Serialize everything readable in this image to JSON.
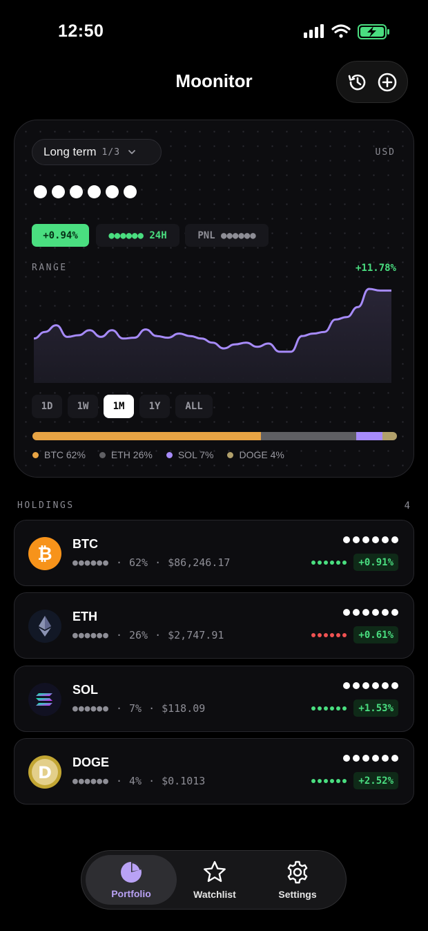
{
  "status_bar": {
    "time": "12:50"
  },
  "app": {
    "title": "Moonitor"
  },
  "header_actions": {
    "history_icon": "history-icon",
    "add_icon": "plus-circle-icon"
  },
  "portfolio": {
    "name": "Long term",
    "index": "1/3",
    "currency": "USD",
    "change_24h_percent": "+0.94%",
    "change_24h_label": "●●●●●● 24H",
    "pnl_label": "PNL ●●●●●●",
    "range_label": "RANGE",
    "range_change": "+11.78%",
    "accent_color": "#a78bfa",
    "positive_color": "#4ade80"
  },
  "chart_data": {
    "type": "area",
    "values": [
      52,
      60,
      68,
      54,
      56,
      62,
      54,
      62,
      52,
      53,
      63,
      55,
      53,
      58,
      55,
      52,
      47,
      40,
      45,
      47,
      42,
      46,
      36,
      36,
      55,
      58,
      60,
      75,
      78,
      90,
      112,
      110,
      110
    ]
  },
  "range_tabs": [
    "1D",
    "1W",
    "1M",
    "1Y",
    "ALL"
  ],
  "range_active": "1M",
  "allocation": [
    {
      "label": "BTC 62%",
      "value": 62,
      "color": "#e8a444"
    },
    {
      "label": "ETH 26%",
      "value": 26,
      "color": "#5f5f63"
    },
    {
      "label": "SOL 7%",
      "value": 7,
      "color": "#a78bfa"
    },
    {
      "label": "DOGE 4%",
      "value": 4,
      "color": "#b1a06b"
    }
  ],
  "holdings": {
    "label": "HOLDINGS",
    "count": "4",
    "items": [
      {
        "symbol": "BTC",
        "amount": "●●●●●●",
        "share": "62%",
        "price": "$86,246.17",
        "change": "+0.91%",
        "pnl_color": "#4ade80",
        "icon": "bitcoin-icon"
      },
      {
        "symbol": "ETH",
        "amount": "●●●●●●",
        "share": "26%",
        "price": "$2,747.91",
        "change": "+0.61%",
        "pnl_color": "#f05252",
        "icon": "ethereum-icon"
      },
      {
        "symbol": "SOL",
        "amount": "●●●●●●",
        "share": "7%",
        "price": "$118.09",
        "change": "+1.53%",
        "pnl_color": "#4ade80",
        "icon": "solana-icon"
      },
      {
        "symbol": "DOGE",
        "amount": "●●●●●●",
        "share": "4%",
        "price": "$0.1013",
        "change": "+2.52%",
        "pnl_color": "#4ade80",
        "icon": "dogecoin-icon"
      }
    ]
  },
  "tab_bar": {
    "items": [
      {
        "label": "Portfolio",
        "icon": "pie-chart-icon",
        "active": true
      },
      {
        "label": "Watchlist",
        "icon": "star-icon",
        "active": false
      },
      {
        "label": "Settings",
        "icon": "gear-icon",
        "active": false
      }
    ]
  }
}
